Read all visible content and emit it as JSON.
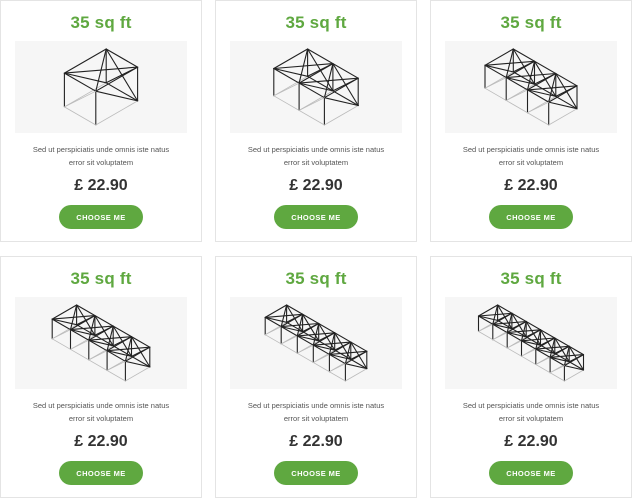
{
  "cards": [
    {
      "title": "35 sq ft",
      "description_line1": "Sed ut perspiciatis unde omnis iste natus",
      "description_line2": "error sit voluptatem",
      "price": "£ 22.90",
      "button_label": "CHOOSE ME",
      "image_icon": "greenhouse-frame-1-bay-icon"
    },
    {
      "title": "35 sq ft",
      "description_line1": "Sed ut perspiciatis unde omnis iste natus",
      "description_line2": "error sit voluptatem",
      "price": "£ 22.90",
      "button_label": "CHOOSE ME",
      "image_icon": "greenhouse-frame-2-bay-icon"
    },
    {
      "title": "35 sq ft",
      "description_line1": "Sed ut perspiciatis unde omnis iste natus",
      "description_line2": "error sit voluptatem",
      "price": "£ 22.90",
      "button_label": "CHOOSE ME",
      "image_icon": "greenhouse-frame-3-bay-icon"
    },
    {
      "title": "35 sq ft",
      "description_line1": "Sed ut perspiciatis unde omnis iste natus",
      "description_line2": "error sit voluptatem",
      "price": "£ 22.90",
      "button_label": "CHOOSE ME",
      "image_icon": "greenhouse-frame-4-bay-icon"
    },
    {
      "title": "35 sq ft",
      "description_line1": "Sed ut perspiciatis unde omnis iste natus",
      "description_line2": "error sit voluptatem",
      "price": "£ 22.90",
      "button_label": "CHOOSE ME",
      "image_icon": "greenhouse-frame-5-bay-icon"
    },
    {
      "title": "35 sq ft",
      "description_line1": "Sed ut perspiciatis unde omnis iste natus",
      "description_line2": "error sit voluptatem",
      "price": "£ 22.90",
      "button_label": "CHOOSE ME",
      "image_icon": "greenhouse-frame-6-bay-icon"
    }
  ],
  "colors": {
    "accent": "#5fa840",
    "price_text": "#333333",
    "image_bg": "#f6f6f6"
  }
}
